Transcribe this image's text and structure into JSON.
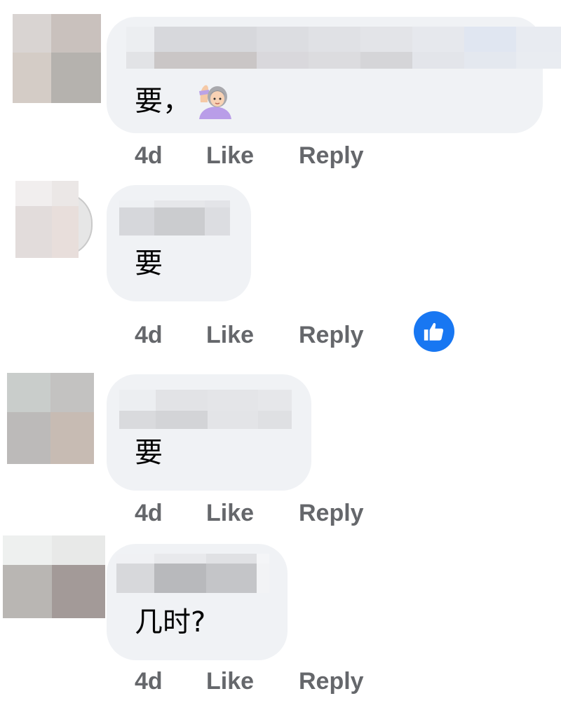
{
  "comments": [
    {
      "text": "要，",
      "emoji": "woman-raising-hand-icon",
      "time": "4d",
      "like_label": "Like",
      "reply_label": "Reply"
    },
    {
      "text": "要",
      "time": "4d",
      "like_label": "Like",
      "reply_label": "Reply",
      "reaction": "like-reaction-icon"
    },
    {
      "text": "要",
      "time": "4d",
      "like_label": "Like",
      "reply_label": "Reply"
    },
    {
      "text": "几时?",
      "time": "4d",
      "like_label": "Like",
      "reply_label": "Reply"
    }
  ],
  "colors": {
    "bubble": "#f0f2f5",
    "meta_text": "#65676b",
    "reaction_blue": "#1877f2"
  }
}
